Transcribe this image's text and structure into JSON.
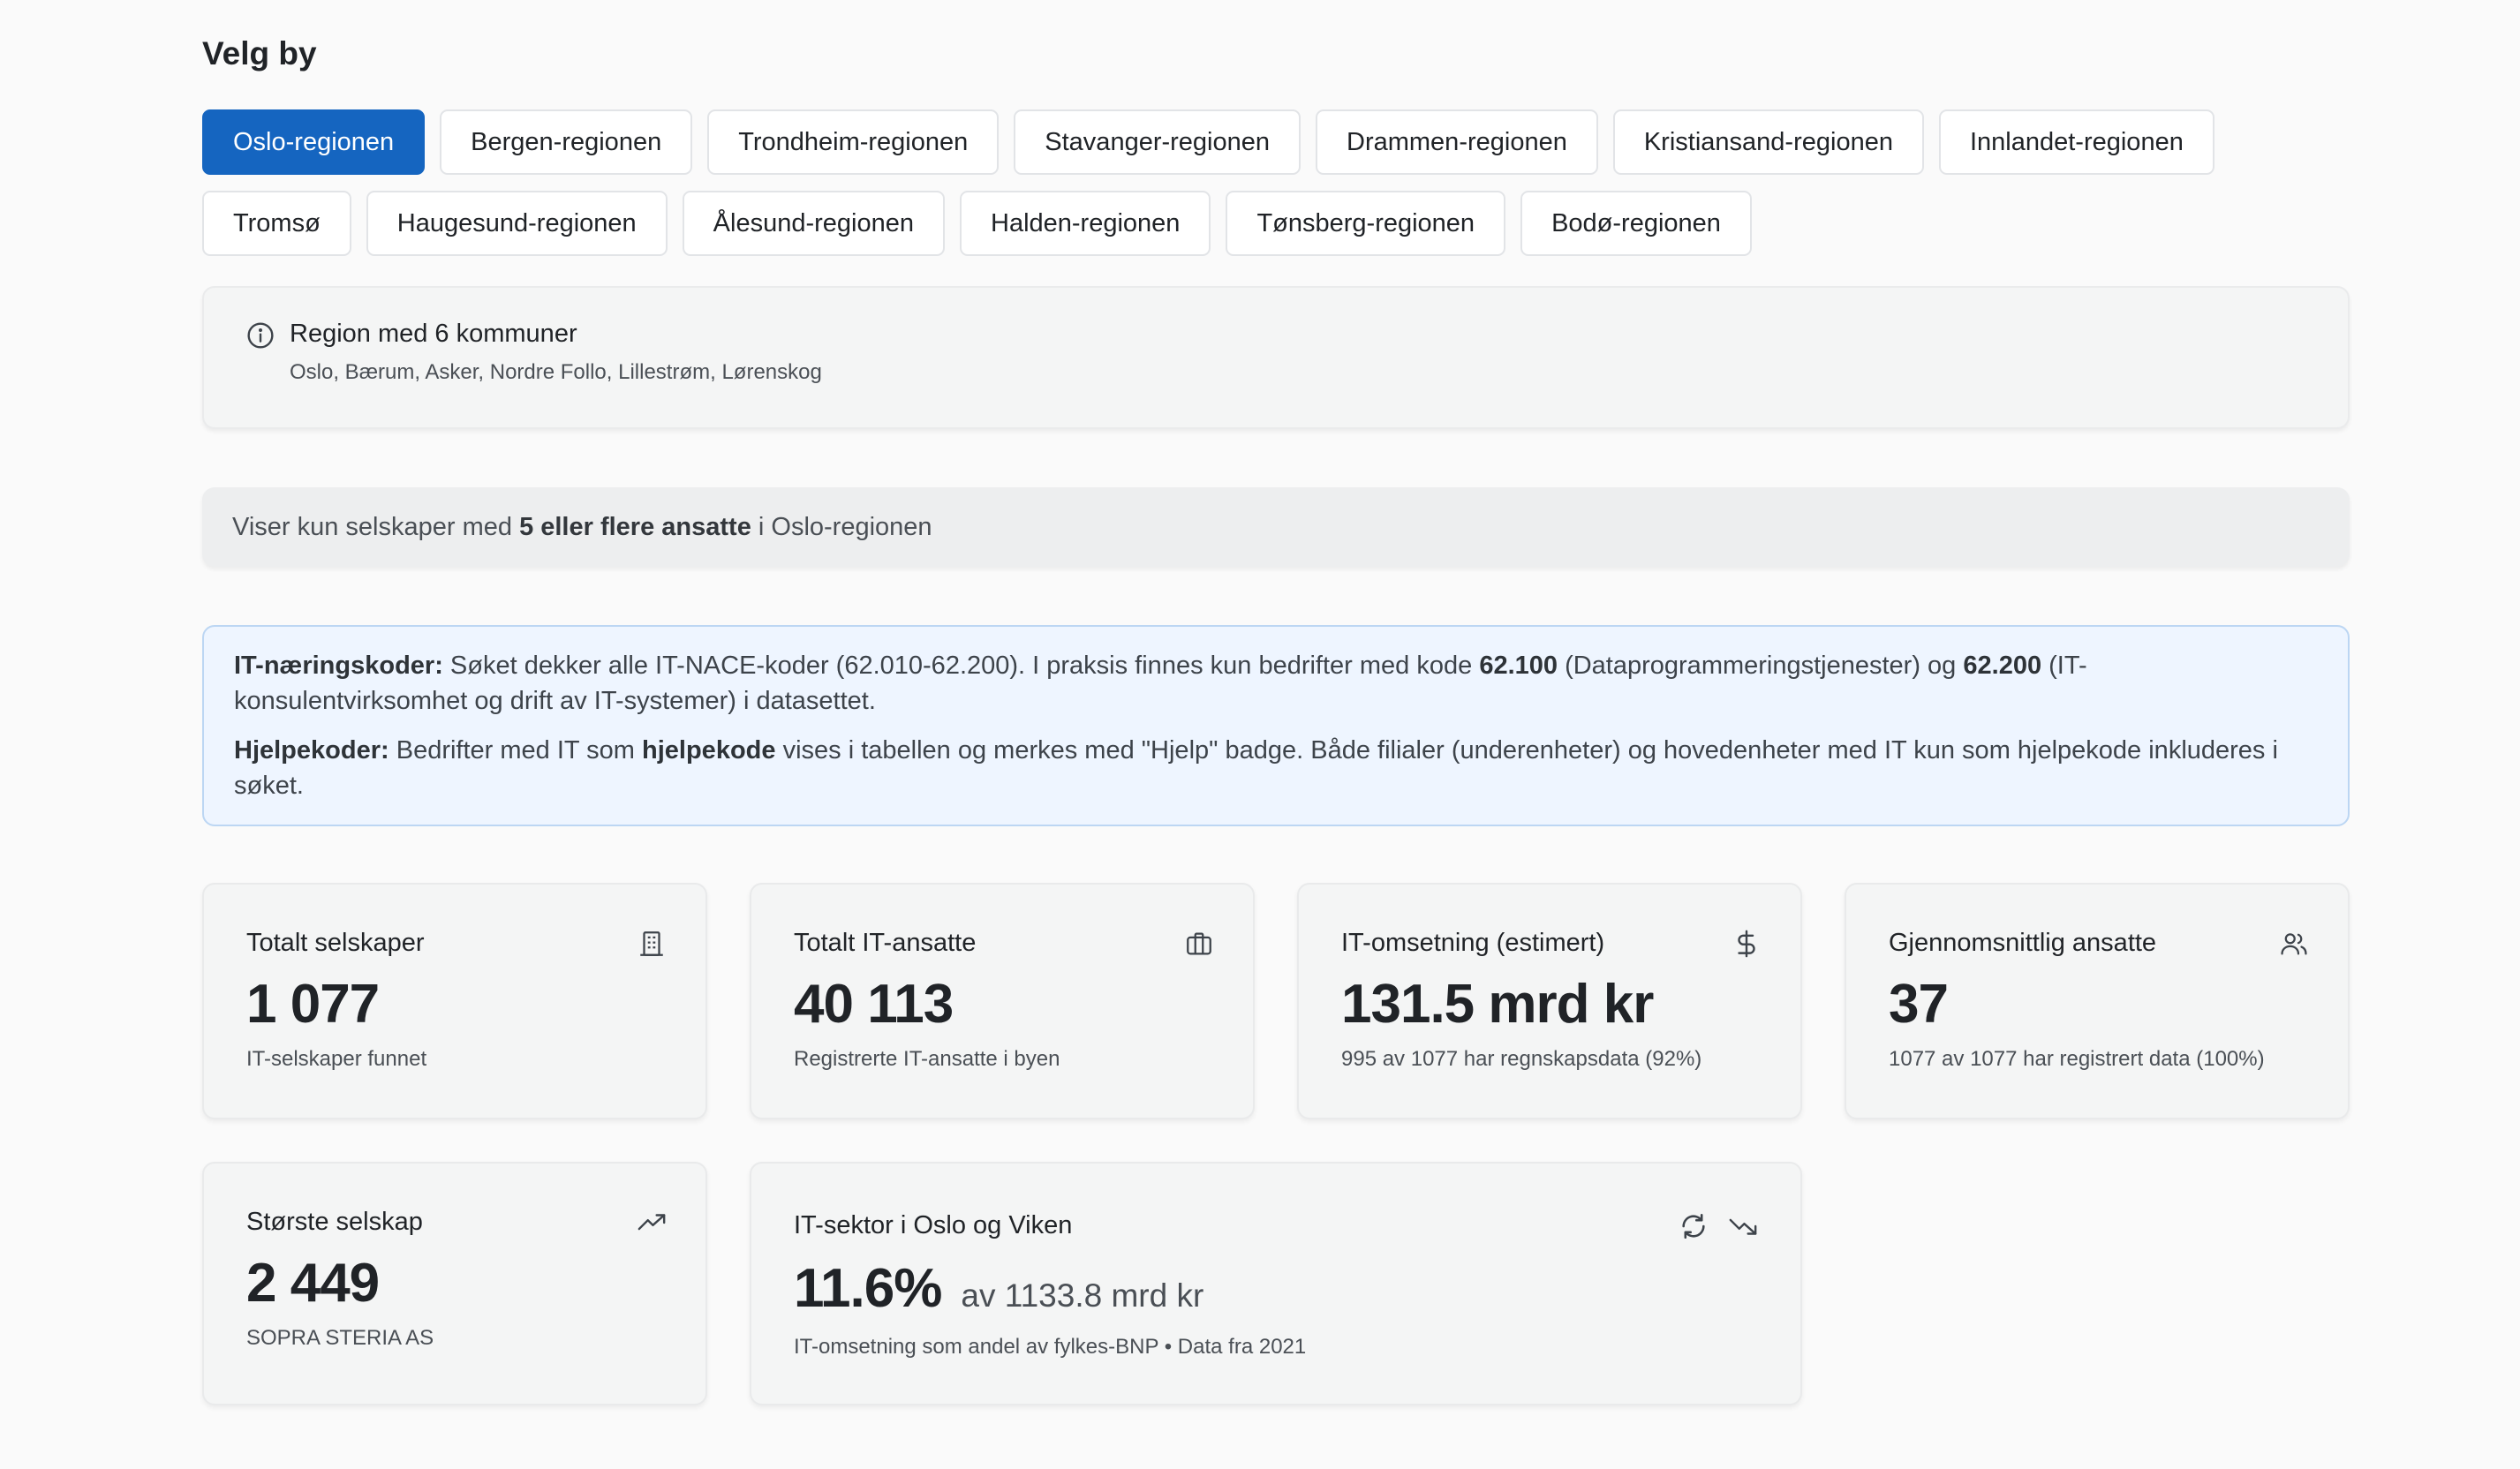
{
  "page": {
    "title": "Velg by"
  },
  "cities": {
    "row1": [
      {
        "label": "Oslo-regionen",
        "active": true
      },
      {
        "label": "Bergen-regionen"
      },
      {
        "label": "Trondheim-regionen"
      },
      {
        "label": "Stavanger-regionen"
      },
      {
        "label": "Drammen-regionen"
      },
      {
        "label": "Kristiansand-regionen"
      },
      {
        "label": "Innlandet-regionen"
      }
    ],
    "row2": [
      {
        "label": "Tromsø"
      },
      {
        "label": "Haugesund-regionen"
      },
      {
        "label": "Ålesund-regionen"
      },
      {
        "label": "Halden-regionen"
      },
      {
        "label": "Tønsberg-regionen"
      },
      {
        "label": "Bodø-regionen"
      }
    ]
  },
  "region_info": {
    "icon": "info-icon",
    "title": "Region med 6 kommuner",
    "municipalities": "Oslo, Bærum, Asker, Nordre Follo, Lillestrøm, Lørenskog"
  },
  "filter": {
    "prefix": "Viser kun selskaper med ",
    "bold": "5 eller flere ansatte",
    "suffix": " i Oslo-regionen"
  },
  "notes": {
    "nace": {
      "label": "IT-næringskoder:",
      "text1": " Søket dekker alle IT-NACE-koder (62.010-62.200). I praksis finnes kun bedrifter med kode ",
      "code1": "62.100",
      "text2": " (Dataprogrammeringstjenester) og ",
      "code2": "62.200",
      "text3": " (IT-konsulentvirksomhet og drift av IT-systemer) i datasettet."
    },
    "help": {
      "label": "Hjelpekoder:",
      "text1": " Bedrifter med IT som ",
      "bold": "hjelpekode",
      "text2": " vises i tabellen og merkes med \"Hjelp\" badge. Både filialer (underenheter) og hovedenheter med IT kun som hjelpekode inkluderes i søket."
    }
  },
  "stats": {
    "total_companies": {
      "label": "Totalt selskaper",
      "value": "1 077",
      "sub": "IT-selskaper funnet",
      "icon": "building-icon"
    },
    "total_employees": {
      "label": "Totalt IT-ansatte",
      "value": "40 113",
      "sub": "Registrerte IT-ansatte i byen",
      "icon": "briefcase-icon"
    },
    "revenue": {
      "label": "IT-omsetning (estimert)",
      "value": "131.5 mrd kr",
      "sub": "995 av 1077 har regnskapsdata (92%)",
      "icon": "dollar-icon"
    },
    "avg_employees": {
      "label": "Gjennomsnittlig ansatte",
      "value": "37",
      "sub": "1077 av 1077 har registrert data (100%)",
      "icon": "users-icon"
    },
    "largest": {
      "label": "Største selskap",
      "value": "2 449",
      "sub": "SOPRA STERIA AS",
      "icon": "trending-up-icon"
    },
    "sector": {
      "label": "IT-sektor i Oslo og Viken",
      "value": "11.6%",
      "value_suffix": "av 1133.8 mrd kr",
      "sub": "IT-omsetning som andel av fylkes-BNP • Data fra 2021",
      "icons": [
        "refresh-icon",
        "trending-down-icon"
      ]
    }
  },
  "colors": {
    "accent": "#1565c0",
    "note_bg": "#eef5ff",
    "note_border": "#bcd6f3",
    "card_bg": "#f4f5f5"
  }
}
